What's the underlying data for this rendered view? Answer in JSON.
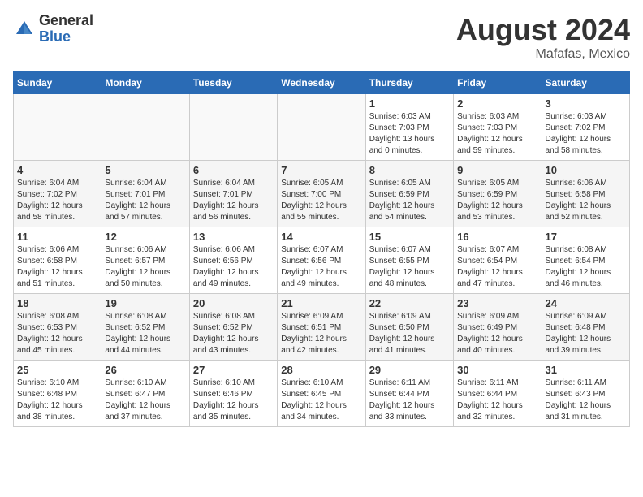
{
  "header": {
    "logo_general": "General",
    "logo_blue": "Blue",
    "month_year": "August 2024",
    "location": "Mafafas, Mexico"
  },
  "days_of_week": [
    "Sunday",
    "Monday",
    "Tuesday",
    "Wednesday",
    "Thursday",
    "Friday",
    "Saturday"
  ],
  "weeks": [
    [
      {
        "day": "",
        "info": ""
      },
      {
        "day": "",
        "info": ""
      },
      {
        "day": "",
        "info": ""
      },
      {
        "day": "",
        "info": ""
      },
      {
        "day": "1",
        "info": "Sunrise: 6:03 AM\nSunset: 7:03 PM\nDaylight: 13 hours\nand 0 minutes."
      },
      {
        "day": "2",
        "info": "Sunrise: 6:03 AM\nSunset: 7:03 PM\nDaylight: 12 hours\nand 59 minutes."
      },
      {
        "day": "3",
        "info": "Sunrise: 6:03 AM\nSunset: 7:02 PM\nDaylight: 12 hours\nand 58 minutes."
      }
    ],
    [
      {
        "day": "4",
        "info": "Sunrise: 6:04 AM\nSunset: 7:02 PM\nDaylight: 12 hours\nand 58 minutes."
      },
      {
        "day": "5",
        "info": "Sunrise: 6:04 AM\nSunset: 7:01 PM\nDaylight: 12 hours\nand 57 minutes."
      },
      {
        "day": "6",
        "info": "Sunrise: 6:04 AM\nSunset: 7:01 PM\nDaylight: 12 hours\nand 56 minutes."
      },
      {
        "day": "7",
        "info": "Sunrise: 6:05 AM\nSunset: 7:00 PM\nDaylight: 12 hours\nand 55 minutes."
      },
      {
        "day": "8",
        "info": "Sunrise: 6:05 AM\nSunset: 6:59 PM\nDaylight: 12 hours\nand 54 minutes."
      },
      {
        "day": "9",
        "info": "Sunrise: 6:05 AM\nSunset: 6:59 PM\nDaylight: 12 hours\nand 53 minutes."
      },
      {
        "day": "10",
        "info": "Sunrise: 6:06 AM\nSunset: 6:58 PM\nDaylight: 12 hours\nand 52 minutes."
      }
    ],
    [
      {
        "day": "11",
        "info": "Sunrise: 6:06 AM\nSunset: 6:58 PM\nDaylight: 12 hours\nand 51 minutes."
      },
      {
        "day": "12",
        "info": "Sunrise: 6:06 AM\nSunset: 6:57 PM\nDaylight: 12 hours\nand 50 minutes."
      },
      {
        "day": "13",
        "info": "Sunrise: 6:06 AM\nSunset: 6:56 PM\nDaylight: 12 hours\nand 49 minutes."
      },
      {
        "day": "14",
        "info": "Sunrise: 6:07 AM\nSunset: 6:56 PM\nDaylight: 12 hours\nand 49 minutes."
      },
      {
        "day": "15",
        "info": "Sunrise: 6:07 AM\nSunset: 6:55 PM\nDaylight: 12 hours\nand 48 minutes."
      },
      {
        "day": "16",
        "info": "Sunrise: 6:07 AM\nSunset: 6:54 PM\nDaylight: 12 hours\nand 47 minutes."
      },
      {
        "day": "17",
        "info": "Sunrise: 6:08 AM\nSunset: 6:54 PM\nDaylight: 12 hours\nand 46 minutes."
      }
    ],
    [
      {
        "day": "18",
        "info": "Sunrise: 6:08 AM\nSunset: 6:53 PM\nDaylight: 12 hours\nand 45 minutes."
      },
      {
        "day": "19",
        "info": "Sunrise: 6:08 AM\nSunset: 6:52 PM\nDaylight: 12 hours\nand 44 minutes."
      },
      {
        "day": "20",
        "info": "Sunrise: 6:08 AM\nSunset: 6:52 PM\nDaylight: 12 hours\nand 43 minutes."
      },
      {
        "day": "21",
        "info": "Sunrise: 6:09 AM\nSunset: 6:51 PM\nDaylight: 12 hours\nand 42 minutes."
      },
      {
        "day": "22",
        "info": "Sunrise: 6:09 AM\nSunset: 6:50 PM\nDaylight: 12 hours\nand 41 minutes."
      },
      {
        "day": "23",
        "info": "Sunrise: 6:09 AM\nSunset: 6:49 PM\nDaylight: 12 hours\nand 40 minutes."
      },
      {
        "day": "24",
        "info": "Sunrise: 6:09 AM\nSunset: 6:48 PM\nDaylight: 12 hours\nand 39 minutes."
      }
    ],
    [
      {
        "day": "25",
        "info": "Sunrise: 6:10 AM\nSunset: 6:48 PM\nDaylight: 12 hours\nand 38 minutes."
      },
      {
        "day": "26",
        "info": "Sunrise: 6:10 AM\nSunset: 6:47 PM\nDaylight: 12 hours\nand 37 minutes."
      },
      {
        "day": "27",
        "info": "Sunrise: 6:10 AM\nSunset: 6:46 PM\nDaylight: 12 hours\nand 35 minutes."
      },
      {
        "day": "28",
        "info": "Sunrise: 6:10 AM\nSunset: 6:45 PM\nDaylight: 12 hours\nand 34 minutes."
      },
      {
        "day": "29",
        "info": "Sunrise: 6:11 AM\nSunset: 6:44 PM\nDaylight: 12 hours\nand 33 minutes."
      },
      {
        "day": "30",
        "info": "Sunrise: 6:11 AM\nSunset: 6:44 PM\nDaylight: 12 hours\nand 32 minutes."
      },
      {
        "day": "31",
        "info": "Sunrise: 6:11 AM\nSunset: 6:43 PM\nDaylight: 12 hours\nand 31 minutes."
      }
    ]
  ]
}
